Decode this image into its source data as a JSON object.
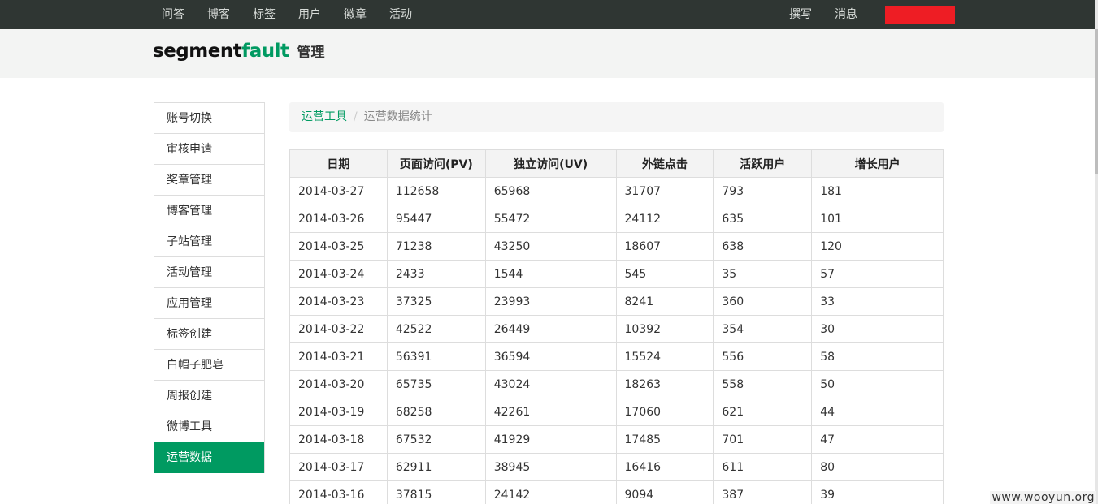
{
  "topnav": {
    "items": [
      "问答",
      "博客",
      "标签",
      "用户",
      "徽章",
      "活动"
    ],
    "right": [
      "撰写",
      "消息"
    ],
    "user_block_color": "#ee1d24"
  },
  "header": {
    "logo_part1": "segment",
    "logo_part2": "fault",
    "subtitle": "管理"
  },
  "sidebar": {
    "items": [
      "账号切换",
      "审核申请",
      "奖章管理",
      "博客管理",
      "子站管理",
      "活动管理",
      "应用管理",
      "标签创建",
      "白帽子肥皂",
      "周报创建",
      "微博工具",
      "运营数据"
    ],
    "active_index": 11
  },
  "breadcrumb": {
    "parent": "运营工具",
    "current": "运营数据统计"
  },
  "table": {
    "headers": [
      "日期",
      "页面访问(PV)",
      "独立访问(UV)",
      "外链点击",
      "活跃用户",
      "增长用户"
    ],
    "rows": [
      [
        "2014-03-27",
        "112658",
        "65968",
        "31707",
        "793",
        "181"
      ],
      [
        "2014-03-26",
        "95447",
        "55472",
        "24112",
        "635",
        "101"
      ],
      [
        "2014-03-25",
        "71238",
        "43250",
        "18607",
        "638",
        "120"
      ],
      [
        "2014-03-24",
        "2433",
        "1544",
        "545",
        "35",
        "57"
      ],
      [
        "2014-03-23",
        "37325",
        "23993",
        "8241",
        "360",
        "33"
      ],
      [
        "2014-03-22",
        "42522",
        "26449",
        "10392",
        "354",
        "30"
      ],
      [
        "2014-03-21",
        "56391",
        "36594",
        "15524",
        "556",
        "58"
      ],
      [
        "2014-03-20",
        "65735",
        "43024",
        "18263",
        "558",
        "50"
      ],
      [
        "2014-03-19",
        "68258",
        "42261",
        "17060",
        "621",
        "44"
      ],
      [
        "2014-03-18",
        "67532",
        "41929",
        "17485",
        "701",
        "47"
      ],
      [
        "2014-03-17",
        "62911",
        "38945",
        "16416",
        "611",
        "80"
      ],
      [
        "2014-03-16",
        "37815",
        "24142",
        "9094",
        "387",
        "39"
      ]
    ]
  },
  "watermark": "www.wooyun.org",
  "colors": {
    "topbar": "#2f3633",
    "accent": "#009a61"
  }
}
